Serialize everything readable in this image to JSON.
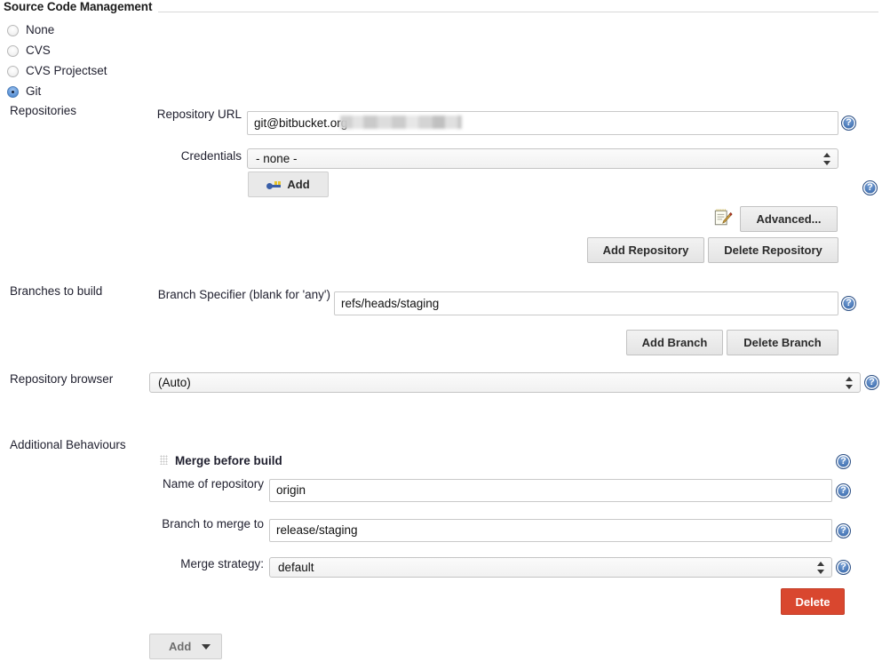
{
  "section": {
    "title": "Source Code Management"
  },
  "scm_options": [
    {
      "label": "None",
      "selected": false
    },
    {
      "label": "CVS",
      "selected": false
    },
    {
      "label": "CVS Projectset",
      "selected": false
    },
    {
      "label": "Git",
      "selected": true
    }
  ],
  "repositories": {
    "group_label": "Repositories",
    "repository_url": {
      "label": "Repository URL",
      "value": "git@bitbucket.org",
      "redacted": true
    },
    "credentials": {
      "label": "Credentials",
      "selected": "- none -",
      "options": [
        "- none -"
      ]
    },
    "add_credentials_button": "Add",
    "advanced_button": "Advanced...",
    "add_repository_button": "Add Repository",
    "delete_repository_button": "Delete Repository"
  },
  "branches": {
    "group_label": "Branches to build",
    "branch_specifier": {
      "label": "Branch Specifier (blank for 'any')",
      "value": "refs/heads/staging"
    },
    "add_branch_button": "Add Branch",
    "delete_branch_button": "Delete Branch"
  },
  "repository_browser": {
    "label": "Repository browser",
    "selected": "(Auto)",
    "options": [
      "(Auto)"
    ]
  },
  "additional_behaviours": {
    "group_label": "Additional Behaviours",
    "behaviour": {
      "title": "Merge before build",
      "name_of_repository": {
        "label": "Name of repository",
        "value": "origin"
      },
      "branch_to_merge_to": {
        "label": "Branch to merge to",
        "value": "release/staging"
      },
      "merge_strategy": {
        "label": "Merge strategy:",
        "selected": "default",
        "options": [
          "default"
        ]
      },
      "delete_button": "Delete"
    },
    "add_button": "Add"
  },
  "icons": {
    "help": "help-icon",
    "key": "key-icon",
    "notepad": "notepad-pencil-icon",
    "grip": "drag-handle-icon",
    "dropdown": "chevron-down-icon"
  },
  "colors": {
    "delete_red": "#d9472f",
    "help_blue": "#4a79b8",
    "radio_selected_blue": "#5b92d6"
  }
}
